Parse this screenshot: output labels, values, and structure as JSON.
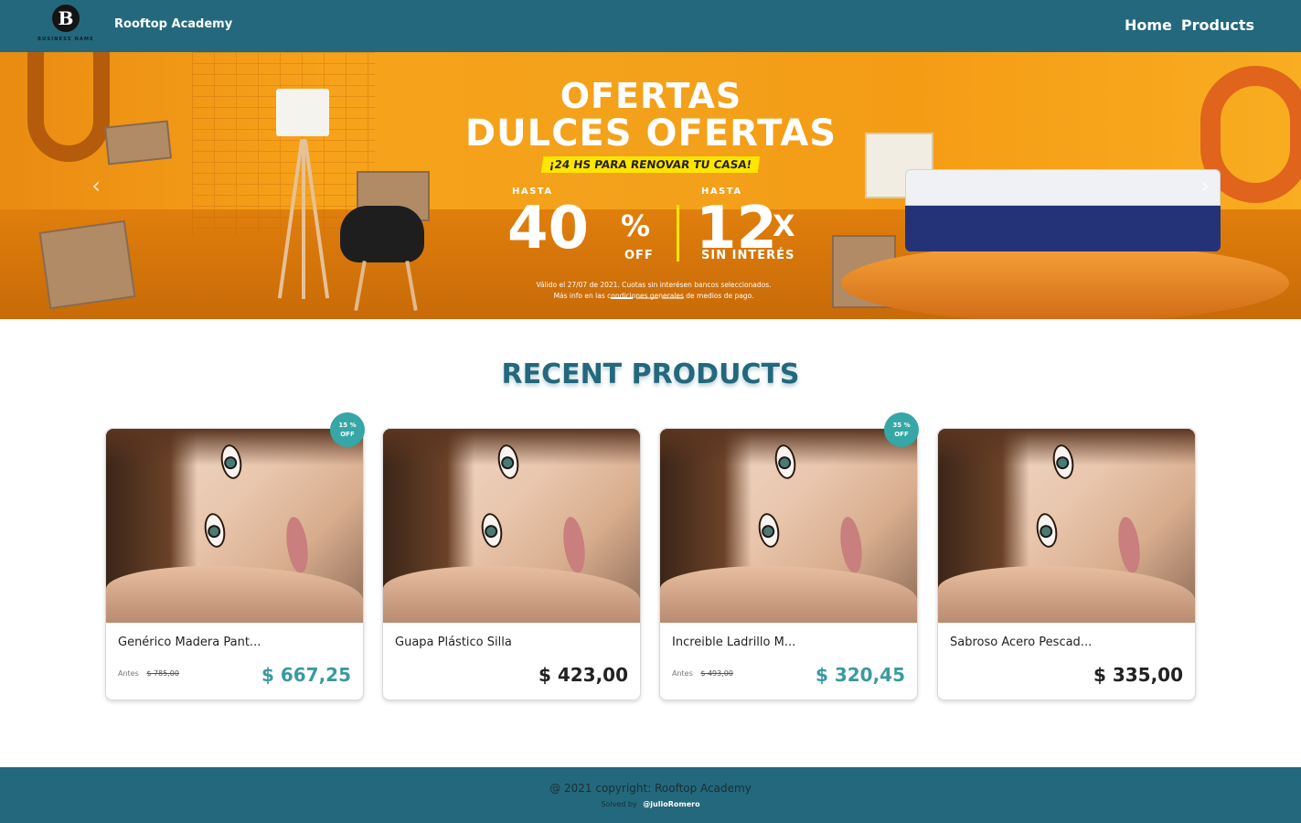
{
  "navbar": {
    "logo_letter": "B",
    "logo_caption": "BUSINESS NAME",
    "brand": "Rooftop Academy",
    "links": [
      {
        "label": "Home"
      },
      {
        "label": "Products"
      }
    ]
  },
  "hero": {
    "line1": "OFERTAS",
    "line2": "DULCES OFERTAS",
    "banner": "¡24 HS PARA RENOVAR TU CASA!",
    "deal1_prefix": "HASTA",
    "deal1_value": "40",
    "deal1_unit": "%",
    "deal1_sub": "OFF",
    "deal2_prefix": "HASTA",
    "deal2_value": "12",
    "deal2_unit": "X",
    "deal2_sub": "SIN INTERÉS",
    "legal_line1": "Válido el 27/07 de 2021. Cuotas sin interésen bancos seleccionados.",
    "legal_line2": "Más info en las condiciones generales de medios de pago.",
    "prev_icon": "‹",
    "next_icon": "›",
    "slide_count": 3,
    "active_slide": 1
  },
  "section": {
    "title": "RECENT PRODUCTS"
  },
  "products": [
    {
      "name": "Genérico Madera Pant...",
      "badge_pct": "15 %",
      "badge_off": "OFF",
      "antes_label": "Antes",
      "antes_price": "$ 785,00",
      "price": "$ 667,25"
    },
    {
      "name": "Guapa Plástico Silla",
      "badge_pct": "",
      "badge_off": "",
      "antes_label": "",
      "antes_price": "",
      "price": "$ 423,00"
    },
    {
      "name": "Increible Ladrillo M...",
      "badge_pct": "35 %",
      "badge_off": "OFF",
      "antes_label": "Antes",
      "antes_price": "$ 493,00",
      "price": "$ 320,45"
    },
    {
      "name": "Sabroso Acero Pescad...",
      "badge_pct": "",
      "badge_off": "",
      "antes_label": "",
      "antes_price": "",
      "price": "$ 335,00"
    }
  ],
  "footer": {
    "copyright": "@ 2021 copyright: Rooftop Academy",
    "solved_by": "Solved by",
    "author": "@julioRomero"
  },
  "colors": {
    "primary": "#23687c",
    "accent": "#36a6a6",
    "sale_price": "#3a9aa0"
  }
}
